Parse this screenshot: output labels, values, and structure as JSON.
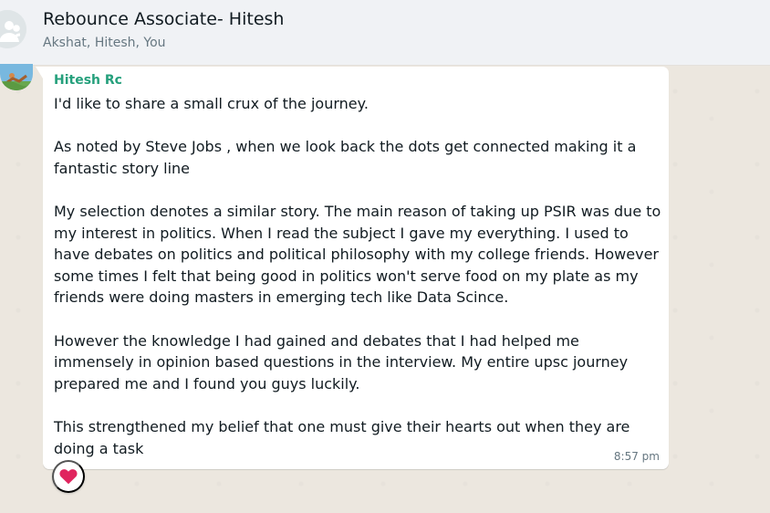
{
  "header": {
    "title": "Rebounce Associate- Hitesh",
    "subtitle": "Akshat, Hitesh, You",
    "avatar_icon": "group-avatar-icon"
  },
  "message": {
    "sender": "Hitesh Rc",
    "sender_color": "#25a07c",
    "paragraphs": [
      "I'd like to share a small crux of the journey.",
      "As noted by Steve Jobs , when we look back the dots get connected making it a fantastic story line",
      "My selection denotes a similar story. The main reason of taking up PSIR was due to my interest in politics. When I read the subject I gave my everything. I used to have debates on politics and political philosophy with my college friends. However some times I felt that being good in politics won't serve food on my plate as my friends were doing masters in emerging tech like Data Scince.",
      "However the knowledge I had gained and debates that I had helped me immensely in opinion based questions in the interview. My entire upsc journey prepared me and I found you guys luckily.",
      "This strengthened my belief that one must give their hearts out when they are doing a task"
    ],
    "time": "8:57 pm",
    "reaction": "heart-icon"
  },
  "colors": {
    "chat_background": "#efeae2",
    "header_background": "#f0f2f5",
    "bubble_background": "#ffffff",
    "text": "#111b21",
    "muted_text": "#667781",
    "reaction_heart": "#e0245e"
  }
}
